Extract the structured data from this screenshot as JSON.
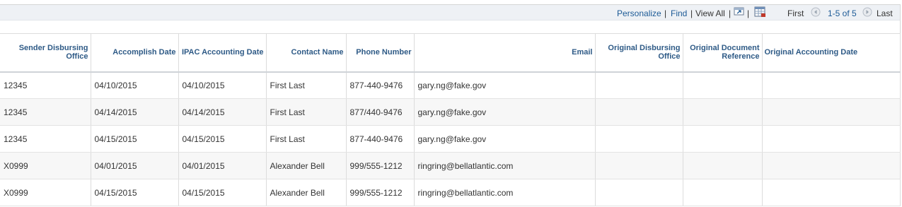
{
  "toolbar": {
    "personalize": "Personalize",
    "sep1": "|",
    "find": "Find",
    "sep2": "|",
    "view_all": "View All",
    "sep3": "|",
    "sep4": "|",
    "first": "First",
    "range": "1-5 of 5",
    "last": "Last"
  },
  "table": {
    "columns": [
      "Sender Disbursing Office",
      "Accomplish Date",
      "IPAC Accounting Date",
      "Contact Name",
      "Phone Number",
      "Email",
      "Original Disbursing Office",
      "Original Document Reference",
      "Original Accounting Date"
    ],
    "rows": [
      [
        "12345",
        "04/10/2015",
        "04/10/2015",
        "First Last",
        "877-440-9476",
        "gary.ng@fake.gov",
        "",
        "",
        ""
      ],
      [
        "12345",
        "04/14/2015",
        "04/14/2015",
        "First Last",
        "877/440-9476",
        "gary.ng@fake.gov",
        "",
        "",
        ""
      ],
      [
        "12345",
        "04/15/2015",
        "04/15/2015",
        "First Last",
        "877-440-9476",
        "gary.ng@fake.gov",
        "",
        "",
        ""
      ],
      [
        "X0999",
        "04/01/2015",
        "04/01/2015",
        "Alexander Bell",
        "999/555-1212",
        "ringring@bellatlantic.com",
        "",
        "",
        ""
      ],
      [
        "X0999",
        "04/15/2015",
        "04/15/2015",
        "Alexander Bell",
        "999/555-1212",
        "ringring@bellatlantic.com",
        "",
        "",
        ""
      ]
    ]
  },
  "colors": {
    "link": "#1c5a96",
    "header_text": "#2e5a86",
    "toolbar_bg": "#eef1f5"
  }
}
